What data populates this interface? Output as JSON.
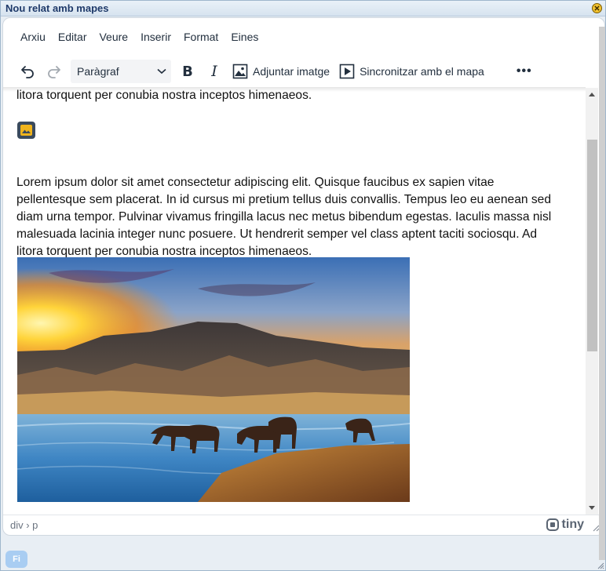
{
  "dialog": {
    "title": "Nou relat amb mapes",
    "footer_button": "Fi"
  },
  "menubar": {
    "items": [
      "Arxiu",
      "Editar",
      "Veure",
      "Inserir",
      "Format",
      "Eines"
    ]
  },
  "toolbar": {
    "undo_icon": "undo-icon",
    "redo_icon": "redo-icon",
    "block_format": "Paràgraf",
    "bold_label": "B",
    "italic_label": "I",
    "attach_image_label": "Adjuntar imatge",
    "sync_map_label": "Sincronitzar amb el mapa",
    "more_label": "•••"
  },
  "content": {
    "paragraph_top_tail": "litora torquent per conubia nostra inceptos himenaeos.",
    "paragraph_main": "Lorem ipsum dolor sit amet consectetur adipiscing elit. Quisque faucibus ex sapien vitae pellentesque sem placerat. In id cursus mi pretium tellus duis convallis. Tempus leo eu aenean sed diam urna tempor. Pulvinar vivamus fringilla lacus nec metus bibendum egestas. Iaculis massa nisl malesuada lacinia integer nunc posuere. Ut hendrerit semper vel class aptent taciti sociosqu. Ad litora torquent per conubia nostra inceptos himenaeos.",
    "image_icon": "image-placeholder-icon",
    "photo_subject": "horses drinking at a mountain lake at sunset"
  },
  "statusbar": {
    "path": "div › p",
    "brand": "tiny"
  },
  "colors": {
    "title_text": "#1f3a6a",
    "editor_text": "#222f3e",
    "placeholder_bg": "#3a4a5d",
    "placeholder_accent": "#f0b41c",
    "fi_button": "#a9cdf2"
  }
}
